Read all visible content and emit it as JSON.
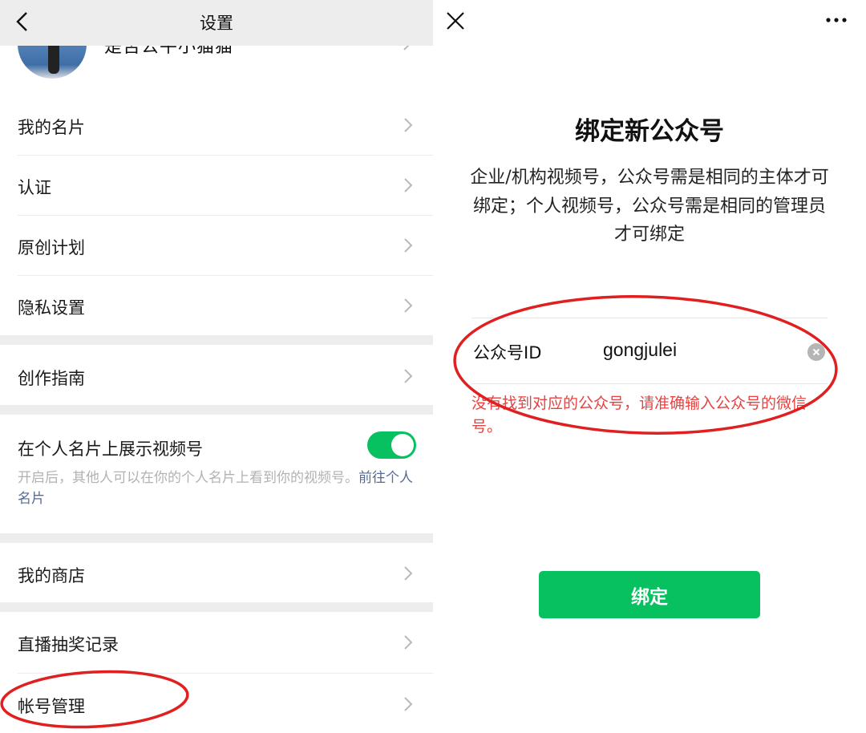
{
  "left": {
    "header": {
      "title": "设置",
      "back_icon": "chevron-left-icon"
    },
    "profile": {
      "name": "是否公平小猫猫"
    },
    "items": [
      {
        "label": "我的名片"
      },
      {
        "label": "认证"
      },
      {
        "label": "原创计划"
      },
      {
        "label": "隐私设置"
      },
      {
        "label": "创作指南"
      },
      {
        "label": "我的商店"
      },
      {
        "label": "直播抽奖记录"
      },
      {
        "label": "帐号管理"
      }
    ],
    "toggle_section": {
      "label": "在个人名片上展示视频号",
      "enabled": true,
      "description": "开启后，其他人可以在你的个人名片上看到你的视频号。",
      "link": "前往个人名片"
    }
  },
  "right": {
    "close_icon": "close-icon",
    "more_icon": "more-dots-icon",
    "title": "绑定新公众号",
    "description": "企业/机构视频号，公众号需是相同的主体才可绑定；个人视频号，公众号需是相同的管理员才可绑定",
    "input": {
      "label": "公众号ID",
      "value": "gongjulei"
    },
    "error": "没有找到对应的公众号，请准确输入公众号的微信号。",
    "bind_button": "绑定"
  },
  "colors": {
    "accent_green": "#07c160",
    "error_red": "#e64340",
    "link_blue": "#576b95",
    "annotation_red": "#e02020"
  }
}
